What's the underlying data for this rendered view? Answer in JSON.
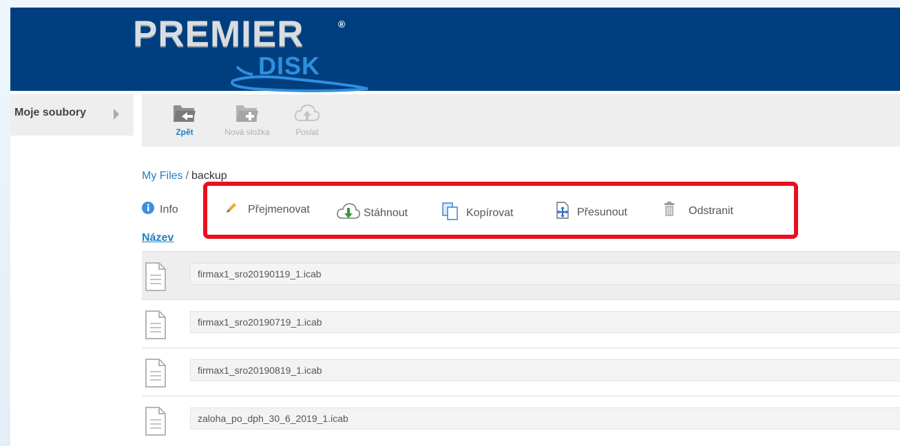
{
  "header": {
    "logo_line1": "PREMIER",
    "logo_line2": "DISK",
    "logo_mark": "®",
    "background_color": "#003f7f"
  },
  "sidebar": {
    "label": "Moje soubory",
    "icon": "chevron-right-icon"
  },
  "toolbar": {
    "items": [
      {
        "label": "Zpět",
        "icon": "folder-back-icon",
        "active": true
      },
      {
        "label": "Nová složka",
        "icon": "folder-add-icon",
        "active": false
      },
      {
        "label": "Poslat",
        "icon": "cloud-upload-icon",
        "active": false
      }
    ]
  },
  "breadcrumb": {
    "root": "My Files",
    "separator": "/",
    "current": "backup"
  },
  "actions": {
    "items": [
      {
        "label": "Info",
        "icon": "info-icon"
      },
      {
        "label": "Přejmenovat",
        "icon": "pencil-icon"
      },
      {
        "label": "Stáhnout",
        "icon": "cloud-download-icon"
      },
      {
        "label": "Kopírovat",
        "icon": "copy-icon"
      },
      {
        "label": "Přesunout",
        "icon": "move-icon"
      },
      {
        "label": "Odstranit",
        "icon": "trash-icon"
      }
    ],
    "highlight_color": "#e8101f"
  },
  "list": {
    "sort_label": "Název",
    "files": [
      {
        "name": "firmax1_sro20190119_1.icab",
        "selected": true
      },
      {
        "name": "firmax1_sro20190719_1.icab",
        "selected": false
      },
      {
        "name": "firmax1_sro20190819_1.icab",
        "selected": false
      },
      {
        "name": "zaloha_po_dph_30_6_2019_1.icab",
        "selected": false
      }
    ]
  }
}
